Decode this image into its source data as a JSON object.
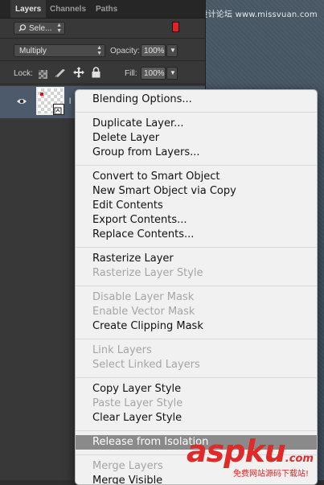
{
  "watermark_top": "思缘设计论坛 www.missvuan.com",
  "panel": {
    "tabs": [
      {
        "label": "Layers",
        "active": true
      },
      {
        "label": "Channels",
        "active": false
      },
      {
        "label": "Paths",
        "active": false
      }
    ],
    "filter_select": {
      "value": "Sele...",
      "icon": "search-icon"
    },
    "filter_color": "#e02222",
    "blend_mode": "Multiply",
    "opacity_label": "Opacity:",
    "opacity_value": "100%",
    "lock_label": "Lock:",
    "fill_label": "Fill:",
    "fill_value": "100%",
    "layer_name_visible": "l"
  },
  "menu": {
    "items": [
      {
        "label": "Blending Options...",
        "enabled": true
      },
      {
        "label": "Duplicate Layer...",
        "enabled": true
      },
      {
        "label": "Delete Layer",
        "enabled": true
      },
      {
        "label": "Group from Layers...",
        "enabled": true
      },
      {
        "label": "Convert to Smart Object",
        "enabled": true
      },
      {
        "label": "New Smart Object via Copy",
        "enabled": true
      },
      {
        "label": "Edit Contents",
        "enabled": true
      },
      {
        "label": "Export Contents...",
        "enabled": true
      },
      {
        "label": "Replace Contents...",
        "enabled": true
      },
      {
        "label": "Rasterize Layer",
        "enabled": true
      },
      {
        "label": "Rasterize Layer Style",
        "enabled": false
      },
      {
        "label": "Disable Layer Mask",
        "enabled": false
      },
      {
        "label": "Enable Vector Mask",
        "enabled": false
      },
      {
        "label": "Create Clipping Mask",
        "enabled": true
      },
      {
        "label": "Link Layers",
        "enabled": false
      },
      {
        "label": "Select Linked Layers",
        "enabled": false
      },
      {
        "label": "Copy Layer Style",
        "enabled": true
      },
      {
        "label": "Paste Layer Style",
        "enabled": false
      },
      {
        "label": "Clear Layer Style",
        "enabled": true
      },
      {
        "label": "Release from Isolation",
        "enabled": true,
        "highlighted": true
      },
      {
        "label": "Merge Layers",
        "enabled": false
      },
      {
        "label": "Merge Visible",
        "enabled": true
      }
    ]
  },
  "watermark_bottom": {
    "word": "aspku",
    "tld": ".com",
    "sub": "免费网站源码下载站!"
  }
}
